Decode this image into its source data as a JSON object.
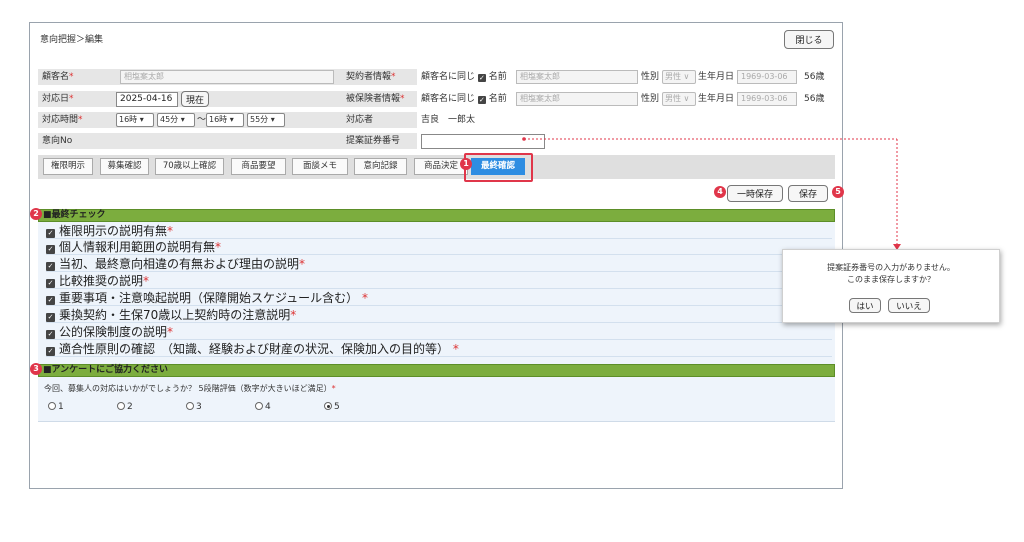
{
  "breadcrumb": "意向把握＞編集",
  "close_label": "閉じる",
  "form": {
    "customer_label": "顧客名",
    "customer_value": "相塩案太郎",
    "contractor_label": "契約者情報",
    "insured_label": "被保険者情報",
    "same_as_customer": "顧客名に同じ",
    "name_label": "名前",
    "contractor_name": "相塩案太郎",
    "insured_name": "相塩案太郎",
    "gender_label": "性別",
    "gender_value": "男性",
    "birth_label": "生年月日",
    "birth_value": "1969-03-06",
    "age": "56歳",
    "date_label": "対応日",
    "date_value": "2025-04-16",
    "now_button": "現在",
    "time_label": "対応時間",
    "start_hour": "16時",
    "start_min": "45分",
    "tilde": "〜",
    "end_hour": "16時",
    "end_min": "55分",
    "handler_label": "対応者",
    "handler_value": "吉良　一郎太",
    "intent_no_label": "意向No",
    "proposal_no_label": "提案証券番号",
    "proposal_no_value": ""
  },
  "tabs": [
    {
      "label": "権限明示"
    },
    {
      "label": "募集確認"
    },
    {
      "label": "70歳以上確認"
    },
    {
      "label": "商品要望"
    },
    {
      "label": "面談メモ"
    },
    {
      "label": "意向記録"
    },
    {
      "label": "商品決定"
    },
    {
      "label": "最終確認"
    }
  ],
  "markers": [
    "1",
    "2",
    "3",
    "4",
    "5"
  ],
  "temp_save_label": "一時保存",
  "save_label": "保存",
  "final_check": {
    "header": "■最終チェック",
    "items": [
      "権限明示の説明有無",
      "個人情報利用範囲の説明有無",
      "当初、最終意向相違の有無および理由の説明",
      "比較推奨の説明",
      "重要事項・注意喚起説明（保障開始スケジュール含む）",
      "乗換契約・生保70歳以上契約時の注意説明",
      "公的保険制度の説明",
      "適合性原則の確認　（知識、経験および財産の状況、保険加入の目的等）"
    ]
  },
  "survey": {
    "header": "■アンケートにご協力ください",
    "question": "今回、募集人の対応はいかがでしょうか？ 5段階評価（数字が大きいほど満足）",
    "options": [
      "1",
      "2",
      "3",
      "4",
      "5"
    ],
    "selected": "5"
  },
  "dialog": {
    "line1": "提案証券番号の入力がありません。",
    "line2": "このまま保存しますか？",
    "yes": "はい",
    "no": "いいえ"
  },
  "colors": {
    "accent_blue": "#2e8de2",
    "section_green": "#7cad3e",
    "annotation_red": "#e0364a"
  }
}
